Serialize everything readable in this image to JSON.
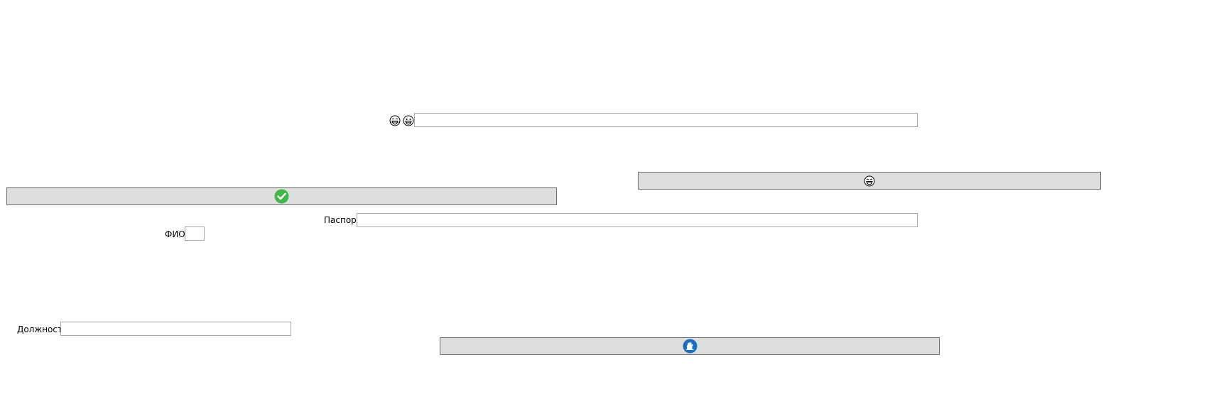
{
  "window": {
    "background": "#ffffff"
  },
  "top_row": {
    "icons": [
      "laughing-face-icon",
      "grinning-face-icon"
    ],
    "input_value": ""
  },
  "emoji_button": {
    "icon": "laughing-face-icon"
  },
  "confirm_button": {
    "icon": "green-checkmark-icon",
    "icon_color": "#43b649"
  },
  "passport": {
    "label": "Паспорт",
    "value": ""
  },
  "fio": {
    "label": "ФИО",
    "value": ""
  },
  "position": {
    "label": "Должность",
    "value": ""
  },
  "blue_button": {
    "icon": "blue-glove-hand-icon",
    "icon_color": "#1a6fc1"
  },
  "colors": {
    "button_face": "#dedede",
    "button_border": "#6f6f6f",
    "input_border": "#a9a9a9"
  }
}
